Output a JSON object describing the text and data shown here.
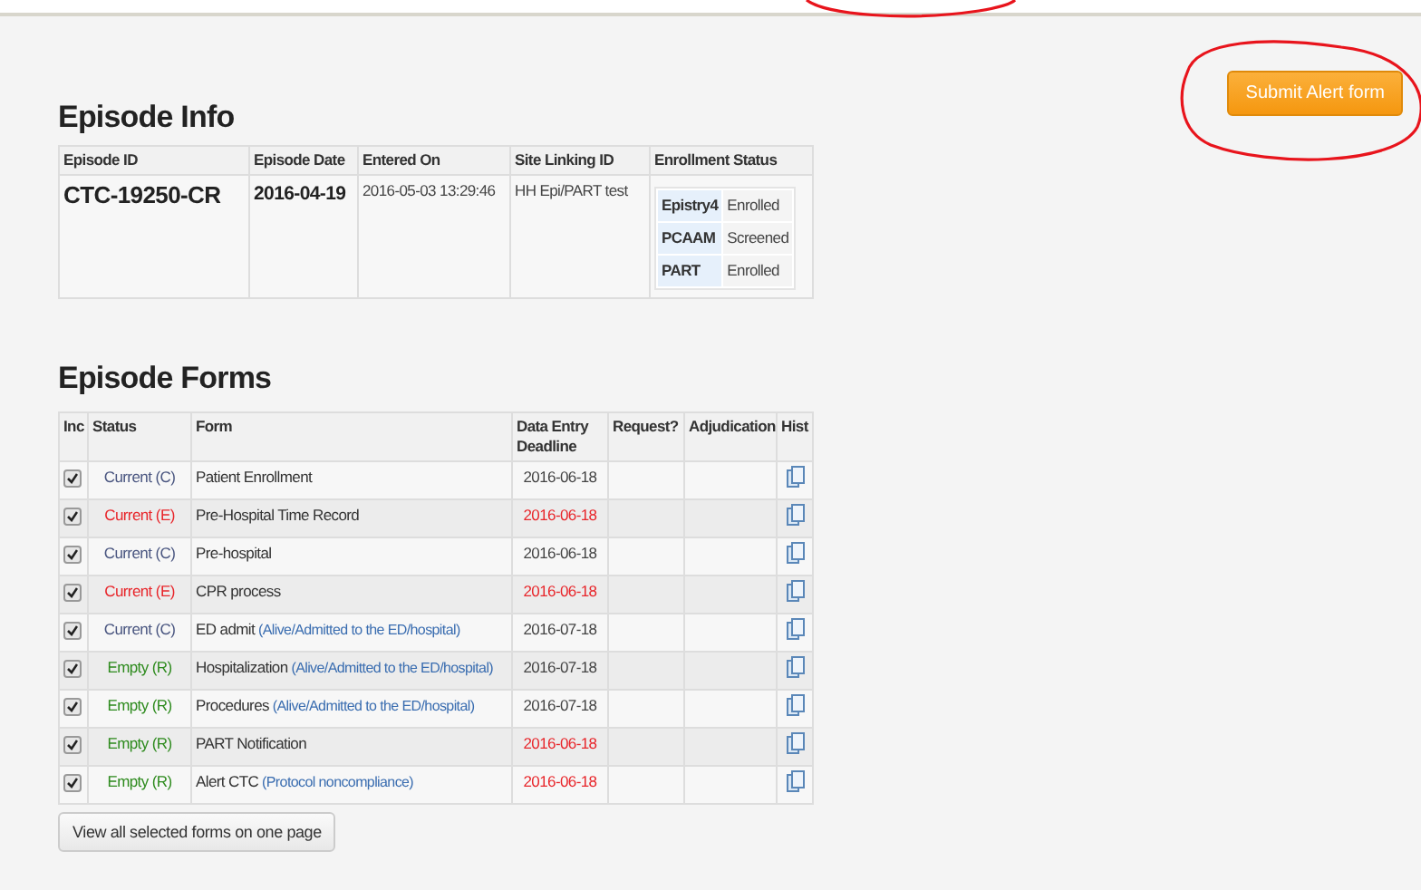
{
  "submit_button": "Submit Alert form",
  "episode_info": {
    "title": "Episode Info",
    "columns": [
      "Episode ID",
      "Episode Date",
      "Entered On",
      "Site Linking ID",
      "Enrollment Status"
    ],
    "episode_id": "CTC-19250-CR",
    "episode_date": "2016-04-19",
    "entered_on": "2016-05-03 13:29:46",
    "site_linking_id": "HH Epi/PART test",
    "enrollment": [
      {
        "study": "Epistry4",
        "status": "Enrolled"
      },
      {
        "study": "PCAAM",
        "status": "Screened"
      },
      {
        "study": "PART",
        "status": "Enrolled"
      }
    ]
  },
  "episode_forms": {
    "title": "Episode Forms",
    "columns": [
      "Inc",
      "Status",
      "Form",
      "Data Entry Deadline",
      "Request?",
      "Adjudication",
      "Hist"
    ],
    "rows": [
      {
        "checked": true,
        "status": "Current (C)",
        "kind": "current",
        "form": "Patient Enrollment",
        "deadline": "2016-06-18",
        "overdue": false
      },
      {
        "checked": true,
        "status": "Current (E)",
        "kind": "error",
        "form": "Pre-Hospital Time Record",
        "deadline": "2016-06-18",
        "overdue": true
      },
      {
        "checked": true,
        "status": "Current (C)",
        "kind": "current",
        "form": "Pre-hospital",
        "deadline": "2016-06-18",
        "overdue": false
      },
      {
        "checked": true,
        "status": "Current (E)",
        "kind": "error",
        "form": "CPR process",
        "deadline": "2016-06-18",
        "overdue": true
      },
      {
        "checked": true,
        "status": "Current (C)",
        "kind": "current",
        "form": "ED admit",
        "note": "(Alive/Admitted to the ED/hospital)",
        "deadline": "2016-07-18",
        "overdue": false
      },
      {
        "checked": true,
        "status": "Empty (R)",
        "kind": "empty",
        "form": "Hospitalization",
        "note": "(Alive/Admitted to the ED/hospital)",
        "deadline": "2016-07-18",
        "overdue": false
      },
      {
        "checked": true,
        "status": "Empty (R)",
        "kind": "empty",
        "form": "Procedures",
        "note": "(Alive/Admitted to the ED/hospital)",
        "deadline": "2016-07-18",
        "overdue": false
      },
      {
        "checked": true,
        "status": "Empty (R)",
        "kind": "empty",
        "form": "PART Notification",
        "deadline": "2016-06-18",
        "overdue": true
      },
      {
        "checked": true,
        "status": "Empty (R)",
        "kind": "empty",
        "form": "Alert CTC",
        "note": "(Protocol noncompliance)",
        "deadline": "2016-06-18",
        "overdue": true
      }
    ],
    "view_all_button": "View all selected forms on one page"
  }
}
